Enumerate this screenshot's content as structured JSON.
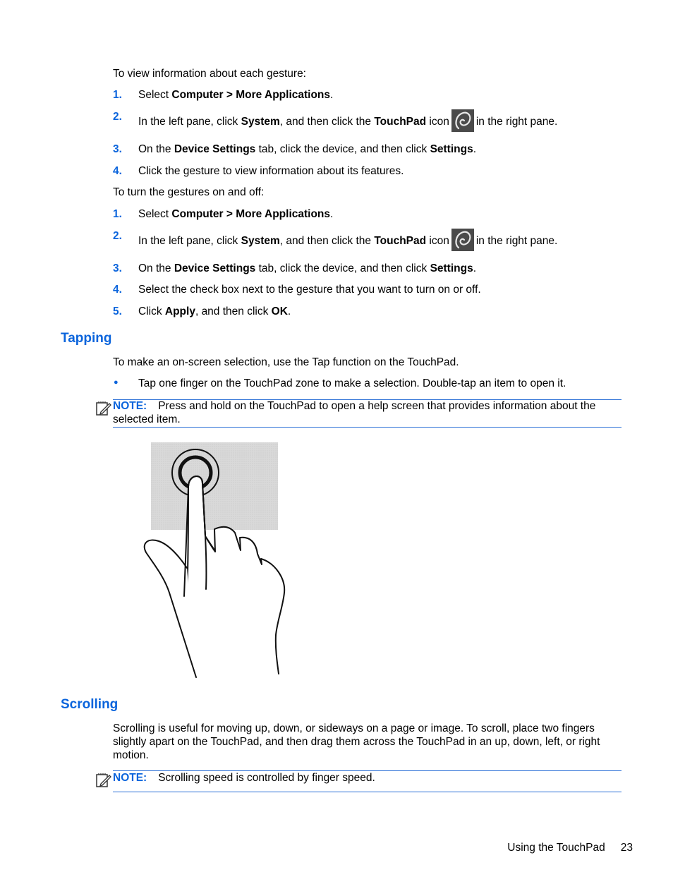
{
  "intro_view": "To view information about each gesture:",
  "view_steps": [
    {
      "num": "1.",
      "parts": [
        "Select ",
        "Computer > More Applications",
        "."
      ]
    },
    {
      "num": "2.",
      "parts": [
        "In the left pane, click ",
        "System",
        ", and then click the ",
        "TouchPad",
        " icon",
        "in the right pane."
      ]
    },
    {
      "num": "3.",
      "parts": [
        "On the ",
        "Device Settings",
        " tab, click the device, and then click ",
        "Settings",
        "."
      ]
    },
    {
      "num": "4.",
      "parts": [
        "Click the gesture to view information about its features."
      ]
    }
  ],
  "intro_toggle": "To turn the gestures on and off:",
  "toggle_steps": [
    {
      "num": "1.",
      "parts": [
        "Select ",
        "Computer > More Applications",
        "."
      ]
    },
    {
      "num": "2.",
      "parts": [
        "In the left pane, click ",
        "System",
        ", and then click the ",
        "TouchPad",
        " icon",
        "in the right pane."
      ]
    },
    {
      "num": "3.",
      "parts": [
        "On the ",
        "Device Settings",
        " tab, click the device, and then click ",
        "Settings",
        "."
      ]
    },
    {
      "num": "4.",
      "parts": [
        "Select the check box next to the gesture that you want to turn on or off."
      ]
    },
    {
      "num": "5.",
      "parts": [
        "Click ",
        "Apply",
        ", and then click ",
        "OK",
        "."
      ]
    }
  ],
  "tapping": {
    "heading": "Tapping",
    "body": "To make an on-screen selection, use the Tap function on the TouchPad.",
    "bullet_symbol": "●",
    "bullet": "Tap one finger on the TouchPad zone to make a selection. Double-tap an item to open it.",
    "note_label": "NOTE:",
    "note_line1": "Press and hold on the TouchPad to open a help screen that provides information about the",
    "note_line2": "selected item."
  },
  "scrolling": {
    "heading": "Scrolling",
    "body_lines": [
      "Scrolling is useful for moving up, down, or sideways on a page or image. To scroll, place two fingers",
      "slightly apart on the TouchPad, and then drag them across the TouchPad in an up, down, left, or right",
      "motion."
    ],
    "note_label": "NOTE:",
    "note_text": "Scrolling speed is controlled by finger speed."
  },
  "footer": {
    "section": "Using the TouchPad",
    "page": "23"
  },
  "colors": {
    "accent": "#0a64dc",
    "rule": "#2a6fd6"
  }
}
